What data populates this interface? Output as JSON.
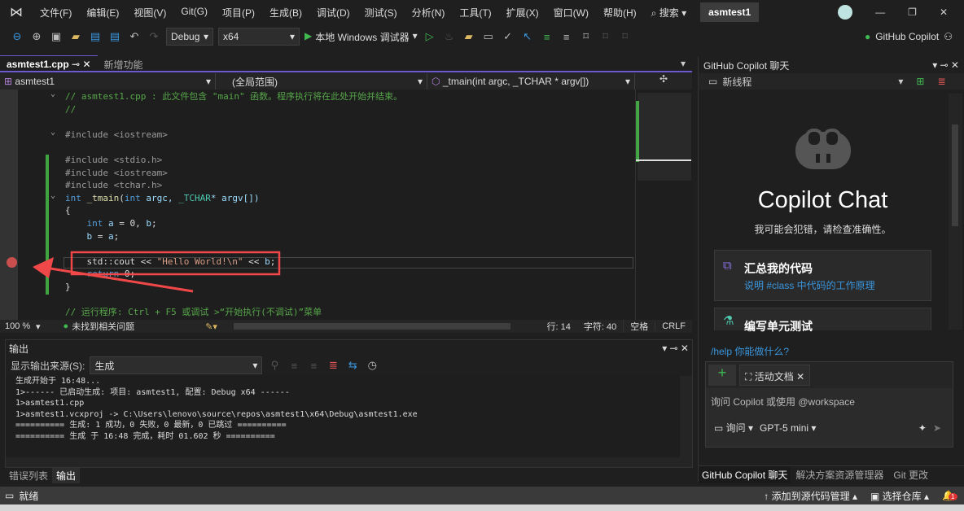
{
  "menu": {
    "items": [
      "文件(F)",
      "编辑(E)",
      "视图(V)",
      "Git(G)",
      "项目(P)",
      "生成(B)",
      "调试(D)",
      "测试(S)",
      "分析(N)",
      "工具(T)",
      "扩展(X)",
      "窗口(W)",
      "帮助(H)"
    ],
    "search": "搜索",
    "solution": "asmtest1"
  },
  "toolbar": {
    "config": "Debug",
    "platform": "x64",
    "run": "本地 Windows 调试器",
    "copilot": "GitHub Copilot"
  },
  "tabs": [
    {
      "label": "asmtest1.cpp",
      "active": true
    },
    {
      "label": "新增功能"
    }
  ],
  "nav": {
    "project": "asmtest1",
    "scope": "(全局范围)",
    "member": "_tmain(int argc, _TCHAR * argv[])"
  },
  "code": [
    [
      [
        "// asmtest1.cpp : 此文件包含 \"main\" 函数。程序执行将在此处开始并结束。",
        "cm"
      ]
    ],
    [
      [
        "//",
        "cm"
      ]
    ],
    [],
    [
      [
        "#include <iostream>",
        "pp"
      ]
    ],
    [],
    [
      [
        "#include <stdio.h>",
        "pp"
      ]
    ],
    [
      [
        "#include <iostream>",
        "pp"
      ]
    ],
    [
      [
        "#include <tchar.h>",
        "pp"
      ]
    ],
    [
      [
        "int ",
        "kw"
      ],
      [
        "_tmain",
        "fn"
      ],
      [
        "(",
        "tx"
      ],
      [
        "int ",
        "kw"
      ],
      [
        "argc, ",
        "id"
      ],
      [
        "_TCHAR",
        "ty"
      ],
      [
        "* argv[])",
        "id"
      ]
    ],
    [
      [
        "{",
        "tx"
      ]
    ],
    [
      [
        "    int ",
        "kw"
      ],
      [
        "a",
        "id"
      ],
      [
        " = 0, ",
        "tx"
      ],
      [
        "b",
        "id"
      ],
      [
        ";",
        "tx"
      ]
    ],
    [
      [
        "    b",
        "id"
      ],
      [
        " = ",
        "tx"
      ],
      [
        "a",
        "id"
      ],
      [
        ";",
        "tx"
      ]
    ],
    [],
    [
      [
        "    std::cout << ",
        "tx"
      ],
      [
        "\"Hello World!\\n\"",
        "st"
      ],
      [
        " << ",
        "tx"
      ],
      [
        "b",
        "id"
      ],
      [
        ";",
        "tx"
      ]
    ],
    [
      [
        "    return ",
        "kw"
      ],
      [
        "0;",
        "tx"
      ]
    ],
    [
      [
        "}",
        "tx"
      ]
    ],
    [],
    [
      [
        "// 运行程序: Ctrl + F5 或调试 >“开始执行(不调试)”菜单",
        "cm"
      ]
    ]
  ],
  "editor_status": {
    "zoom": "100 %",
    "issues": "未找到相关问题",
    "line": "行: 14",
    "col": "字符: 40",
    "whitespace": "空格",
    "eol": "CRLF"
  },
  "output": {
    "title": "输出",
    "source_label": "显示输出来源(S):",
    "source": "生成",
    "lines": [
      "生成开始于 16:48...",
      "1>------ 已启动生成: 项目: asmtest1, 配置: Debug x64 ------",
      "1>asmtest1.cpp",
      "1>asmtest1.vcxproj -> C:\\Users\\lenovo\\source\\repos\\asmtest1\\x64\\Debug\\asmtest1.exe",
      "========== 生成: 1 成功，0 失败，0 最新，0 已跳过 ==========",
      "========== 生成 于 16:48 完成，耗时 01.602 秒 =========="
    ]
  },
  "bottom_tabs": [
    "错误列表",
    "输出"
  ],
  "status": {
    "ready": "就绪",
    "add_source": "添加到源代码管理",
    "repo": "选择仓库",
    "notifications": "1"
  },
  "copilot": {
    "title": "GitHub Copilot 聊天",
    "thread": "新线程",
    "heading": "Copilot Chat",
    "disclaimer": "我可能会犯错，请检查准确性。",
    "cards": [
      {
        "title": "汇总我的代码",
        "sub": "说明 #class 中代码的工作原理"
      },
      {
        "title": "编写单元测试"
      }
    ],
    "help": "/help 你能做什么?",
    "context": "活动文档",
    "placeholder": "询问 Copilot 或使用 @workspace",
    "mode": "询问",
    "model": "GPT-5 mini",
    "tabs": [
      "GitHub Copilot 聊天",
      "解决方案资源管理器",
      "Git 更改"
    ]
  },
  "colors": {
    "accent": "#6c5bd0",
    "breakpoint": "#c94f4f",
    "annotation": "#f04848",
    "changed": "#3fa33f"
  }
}
